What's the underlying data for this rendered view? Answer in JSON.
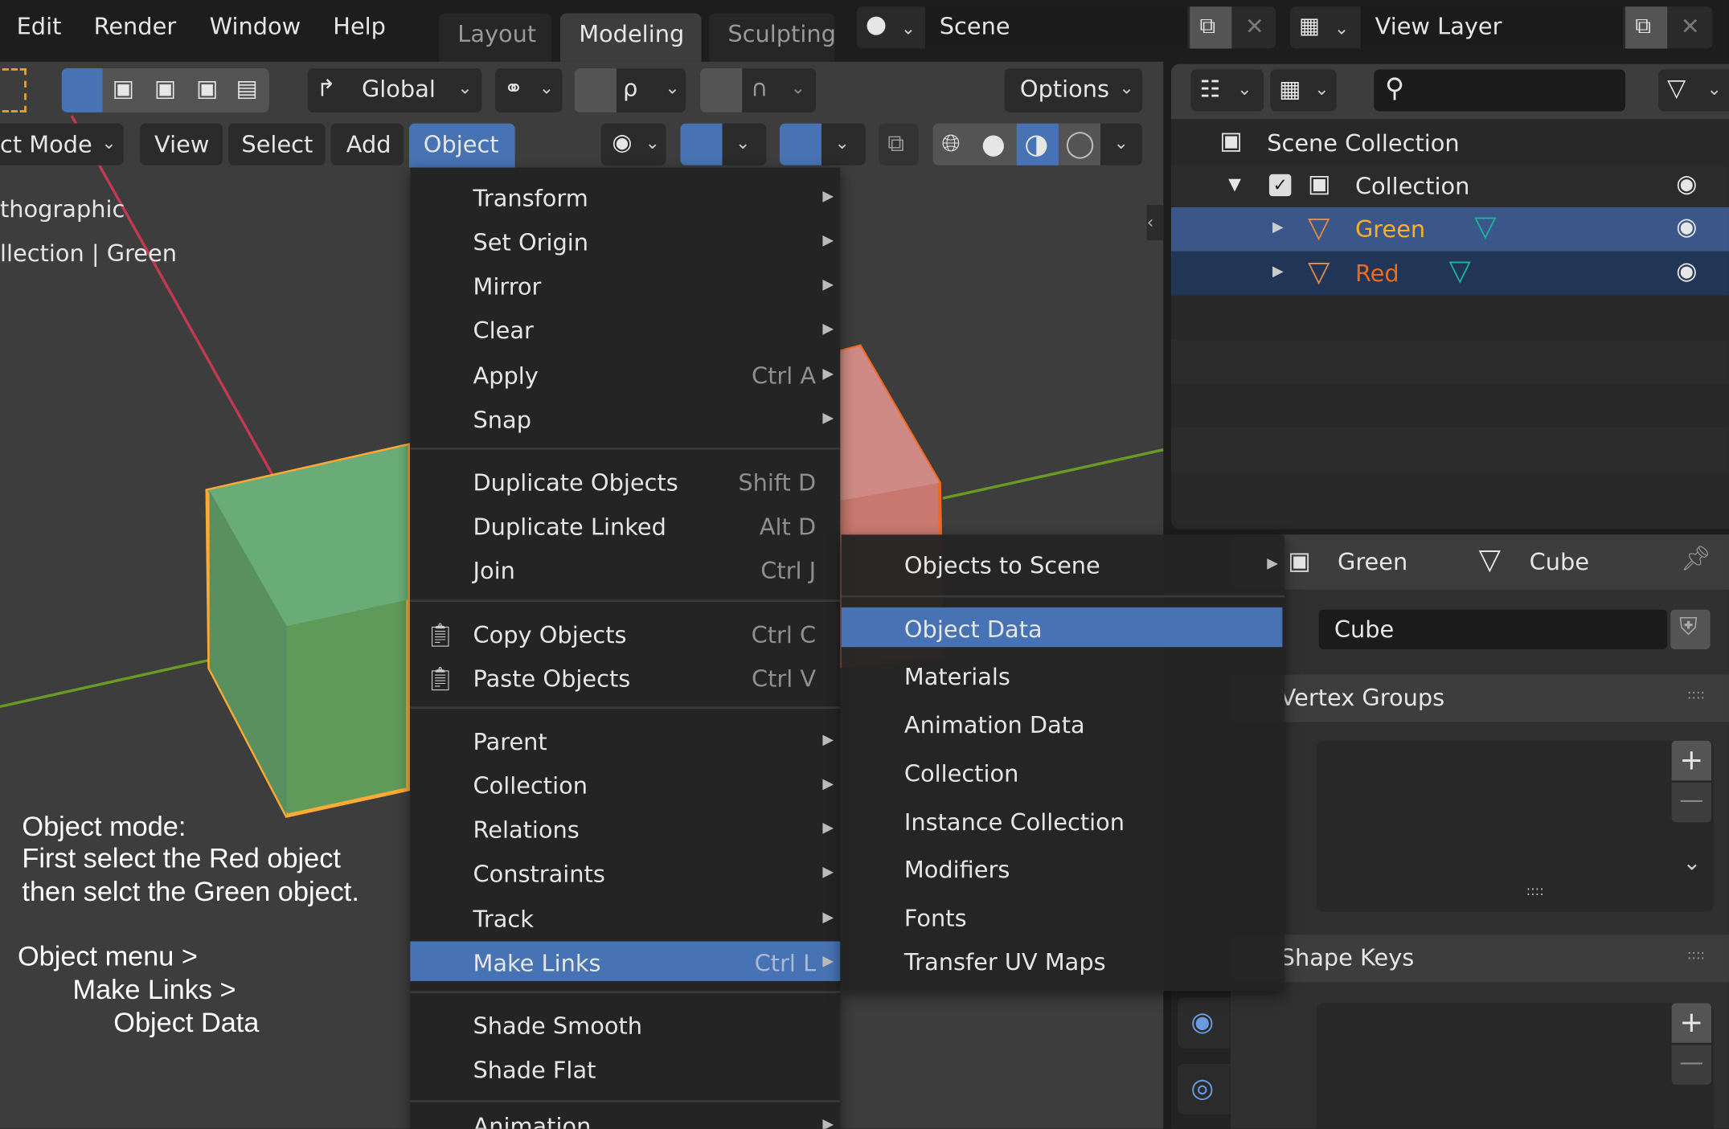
{
  "topbar": {
    "menus": [
      "Edit",
      "Render",
      "Window",
      "Help"
    ],
    "workspaces": [
      {
        "label": "Layout",
        "active": false
      },
      {
        "label": "Modeling",
        "active": true
      },
      {
        "label": "Sculpting",
        "active": false
      }
    ],
    "scene": "Scene",
    "view_layer": "View Layer"
  },
  "viewport": {
    "tool_row": {
      "orientation": "Global",
      "options": "Options"
    },
    "header": {
      "mode": "ct Mode",
      "menus": [
        "View",
        "Select",
        "Add",
        "Object"
      ],
      "active_menu": "Object"
    },
    "overlay_text": [
      "thographic",
      "llection | Green"
    ],
    "instructions": [
      "Object mode:",
      "First select the Red object",
      "then selct the Green object.",
      "Object menu >",
      "Make Links >",
      "Object Data"
    ],
    "colors": {
      "green_cube": "#5fa06a",
      "red_cube": "#c8786e",
      "selection_active": "#ffaa33",
      "selection": "#f06a1e",
      "x_axis": "#c23a52",
      "y_axis": "#6a9a23"
    }
  },
  "object_menu": {
    "items": [
      {
        "label": "Transform",
        "submenu": true
      },
      {
        "label": "Set Origin",
        "submenu": true
      },
      {
        "label": "Mirror",
        "submenu": true
      },
      {
        "label": "Clear",
        "submenu": true
      },
      {
        "label": "Apply",
        "shortcut": "Ctrl A",
        "submenu": true
      },
      {
        "label": "Snap",
        "submenu": true
      },
      {
        "label": "Duplicate Objects",
        "shortcut": "Shift D"
      },
      {
        "label": "Duplicate Linked",
        "shortcut": "Alt D"
      },
      {
        "label": "Join",
        "shortcut": "Ctrl J"
      },
      {
        "label": "Copy Objects",
        "shortcut": "Ctrl C",
        "icon": "copy-icon"
      },
      {
        "label": "Paste Objects",
        "shortcut": "Ctrl V",
        "icon": "paste-icon"
      },
      {
        "label": "Parent",
        "submenu": true
      },
      {
        "label": "Collection",
        "submenu": true
      },
      {
        "label": "Relations",
        "submenu": true
      },
      {
        "label": "Constraints",
        "submenu": true
      },
      {
        "label": "Track",
        "submenu": true
      },
      {
        "label": "Make Links",
        "shortcut": "Ctrl L",
        "submenu": true,
        "highlighted": true
      },
      {
        "label": "Shade Smooth"
      },
      {
        "label": "Shade Flat"
      },
      {
        "label": "Animation",
        "submenu": true
      }
    ]
  },
  "make_links_menu": {
    "items": [
      {
        "label": "Objects to Scene",
        "submenu": true
      },
      {
        "label": "Object Data",
        "highlighted": true
      },
      {
        "label": "Materials"
      },
      {
        "label": "Animation Data"
      },
      {
        "label": "Collection"
      },
      {
        "label": "Instance Collection"
      },
      {
        "label": "Modifiers"
      },
      {
        "label": "Fonts"
      },
      {
        "label": "Transfer UV Maps"
      }
    ]
  },
  "outliner": {
    "scene_collection": "Scene Collection",
    "collection": "Collection",
    "objects": [
      {
        "name": "Green",
        "active": true,
        "color": "#ffaf29"
      },
      {
        "name": "Red",
        "selected": true,
        "color": "#f06a1e"
      }
    ]
  },
  "properties": {
    "breadcrumb": {
      "object": "Green",
      "data": "Cube"
    },
    "data_name": "Cube",
    "panels": [
      {
        "title": "Vertex Groups"
      },
      {
        "title": "Shape Keys"
      }
    ]
  }
}
